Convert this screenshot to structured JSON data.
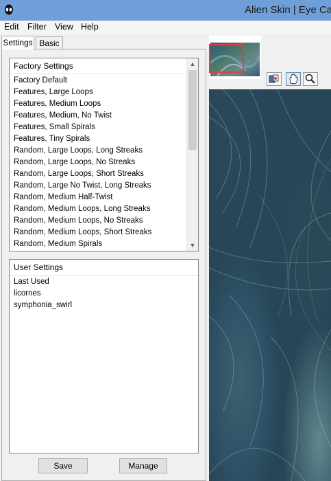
{
  "window": {
    "title": "Alien Skin | Eye Car"
  },
  "menu": {
    "items": [
      "Edit",
      "Filter",
      "View",
      "Help"
    ]
  },
  "tabs": [
    {
      "label": "Settings"
    },
    {
      "label": "Basic"
    }
  ],
  "factory_settings": {
    "header": "Factory Settings",
    "items": [
      "Factory Default",
      "Features, Large Loops",
      "Features, Medium Loops",
      "Features, Medium, No Twist",
      "Features, Small Spirals",
      "Features, Tiny Spirals",
      "Random, Large Loops, Long Streaks",
      "Random, Large Loops, No Streaks",
      "Random, Large Loops, Short Streaks",
      "Random, Large No Twist, Long Streaks",
      "Random, Medium Half-Twist",
      "Random, Medium Loops, Long Streaks",
      "Random, Medium Loops, No Streaks",
      "Random, Medium Loops, Short Streaks",
      "Random, Medium Spirals"
    ]
  },
  "user_settings": {
    "header": "User Settings",
    "items": [
      "Last Used",
      "licornes",
      "symphonia_swirl"
    ]
  },
  "buttons": {
    "save": "Save",
    "manage": "Manage"
  },
  "colors": {
    "titlebar": "#6f9fd8",
    "preview_highlight": "#e04040",
    "texture_base": "#3c5a68"
  },
  "icons": {
    "app": "alien-skin-logo-icon",
    "tools": [
      "pan-compare-icon",
      "hand-icon",
      "zoom-icon"
    ]
  }
}
